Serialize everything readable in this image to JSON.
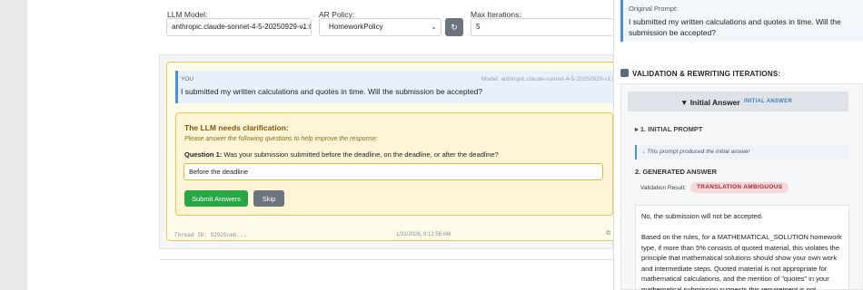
{
  "config": {
    "llm_model_label": "LLM Model:",
    "llm_model_value": "anthropic.claude-sonnet-4-5-20250929-v1:0",
    "ar_policy_label": "AR Policy:",
    "ar_policy_value": "HomeworkPolicy",
    "refresh_icon": "↻",
    "max_iterations_label": "Max Iterations:",
    "max_iterations_value": "5"
  },
  "conversation": {
    "you_label": "YOU",
    "model_tag": "Model: anthropic.claude-sonnet-4-5-20250929-v1:0",
    "user_message": "I submitted my written calculations and quotes in time. Will the submission be accepted?",
    "clarification": {
      "title": "The LLM needs clarification:",
      "subtitle": "Please answer the following questions to help improve the response:",
      "question_label": "Question 1:",
      "question_text": "Was your submission submitted before the deadline, on the deadline, or after the deadline?",
      "answer_value": "Before the deadline",
      "submit_label": "Submit Answers",
      "skip_label": "Skip"
    },
    "thread_id": "Thread ID: 92925ceb...",
    "timestamp": "1/31/2026, 8:12:56 AM"
  },
  "right_panel": {
    "original_prompt_label": "Original Prompt:",
    "original_prompt_text": "I submitted my written calculations and quotes in time. Will the submission be accepted?",
    "validation_header": "VALIDATION & REWRITING ITERATIONS:",
    "iteration_title": "▼  Initial Answer",
    "initial_badge": "INITIAL ANSWER",
    "step1_label": "▸  1. INITIAL PROMPT",
    "produced_note": "↓  This prompt produced the initial answer",
    "generated_answer_label": "2. GENERATED ANSWER",
    "validation_result_label": "Validation Result:",
    "validation_result_value": "TRANSLATION AMBIGUOUS",
    "answer_p1": "No, the submission will not be accepted.",
    "answer_p2": "Based on the rules, for a MATHEMATICAL_SOLUTION homework type, if more than 5% consists of quoted material, this violates the principle that mathematical solutions should show your own work and intermediate steps. Quoted material is not appropriate for mathematical calculations, and the mention of \"quotes\" in your mathematical submission suggests this requirement is not"
  },
  "colors": {
    "accent_blue": "#4a90d9",
    "submit_green": "#28a745",
    "skip_gray": "#6c757d",
    "badge_red": "#f8d7da"
  }
}
